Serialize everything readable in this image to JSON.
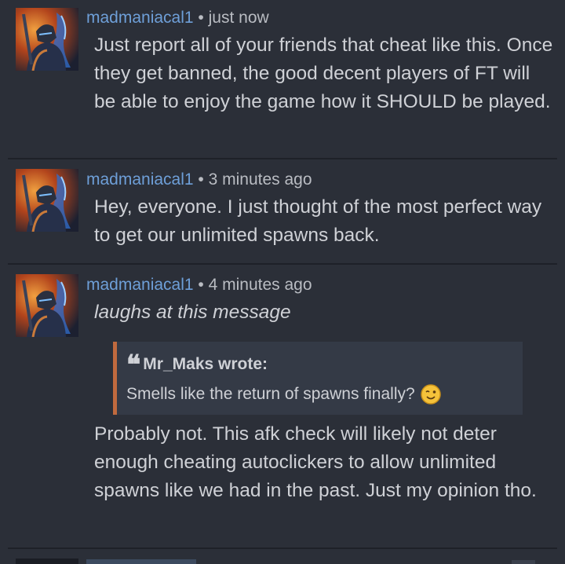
{
  "posts": [
    {
      "username": "madmaniacal1",
      "separator": "•",
      "time": "just now",
      "body": "Just report all of your friends that cheat like this. Once they get banned, the good decent players of FT will be able to enjoy the game how it SHOULD be played."
    },
    {
      "username": "madmaniacal1",
      "separator": "•",
      "time": "3 minutes ago",
      "body": "Hey, everyone. I just thought of the most perfect way to get our unlimited spawns back."
    },
    {
      "username": "madmaniacal1",
      "separator": "•",
      "time": "4 minutes ago",
      "intro": "laughs at this message",
      "quote": {
        "author": "Mr_Maks wrote:",
        "text": "Smells like the return of spawns finally?",
        "emoji": "winking-face-emoji"
      },
      "body": "Probably not. This afk check will likely not deter enough cheating autoclickers to allow unlimited spawns like we had in the past. Just my opinion tho."
    }
  ],
  "colors": {
    "background": "#2b2f38",
    "username": "#6e9fd8",
    "text": "#cfd1d6",
    "meta": "#b9bcc2",
    "quote_background": "#343a46",
    "quote_border": "#c06a3e",
    "divider": "#1e2128"
  },
  "icons": {
    "avatar": "armored-warrior-avatar",
    "quote_mark": "quote-icon"
  }
}
